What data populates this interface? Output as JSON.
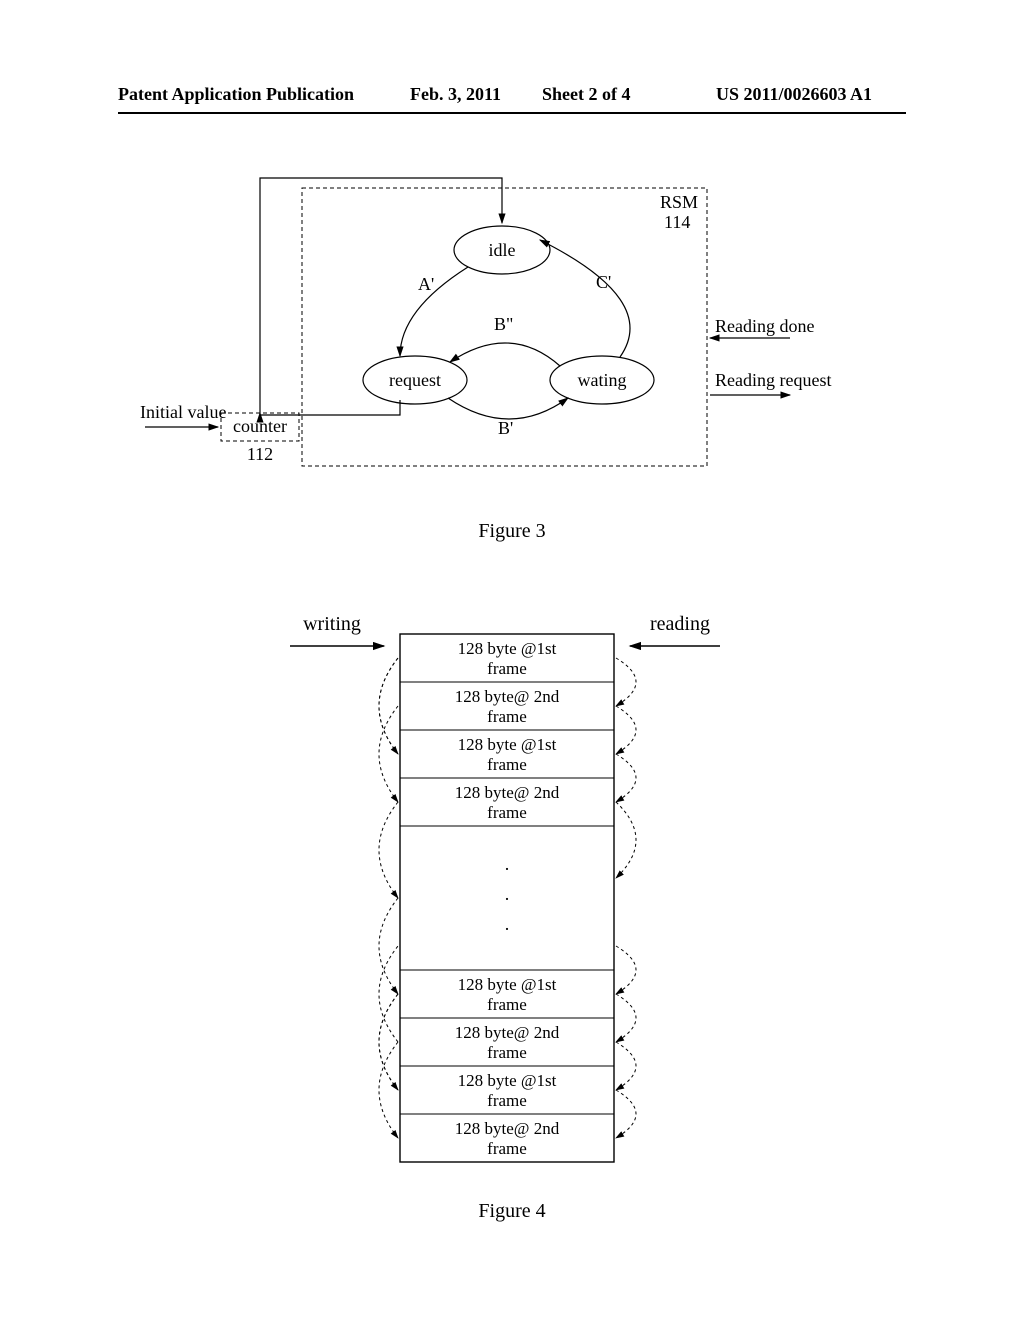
{
  "header": {
    "pub": "Patent Application Publication",
    "date": "Feb. 3, 2011",
    "sheet": "Sheet 2 of 4",
    "docnum": "US 2011/0026603 A1"
  },
  "fig3": {
    "caption": "Figure 3",
    "rsm": "RSM",
    "rsm_num": "114",
    "counter": "counter",
    "counter_num": "112",
    "initial": "Initial value",
    "idle": "idle",
    "request": "request",
    "waiting": "wating",
    "A": "A'",
    "Bp": "B'",
    "Bpp": "B\"",
    "C": "C'",
    "readdone": "Reading done",
    "readreq": "Reading request"
  },
  "fig4": {
    "caption": "Figure 4",
    "writing": "writing",
    "reading": "reading",
    "cells": [
      "128 byte @1st frame",
      "128 byte@ 2nd frame",
      "128 byte @1st frame",
      "128 byte@ 2nd frame",
      "128 byte @1st frame",
      "128 byte@ 2nd frame",
      "128 byte @1st frame",
      "128 byte@ 2nd frame"
    ],
    "dots": "."
  }
}
